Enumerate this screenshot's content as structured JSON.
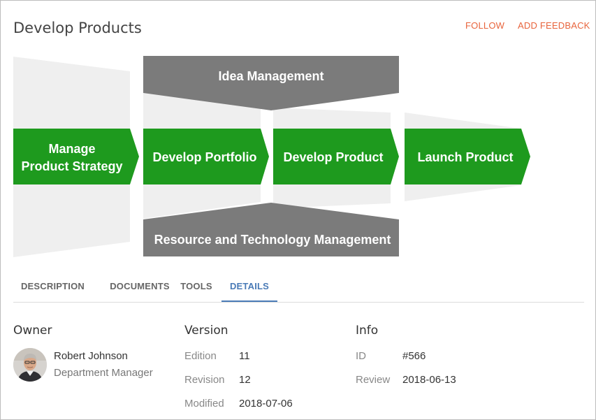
{
  "header": {
    "title": "Develop Products",
    "follow_label": "FOLLOW",
    "feedback_label": "ADD FEEDBACK"
  },
  "process": {
    "top_band": "Idea Management",
    "bottom_band": "Resource and Technology Management",
    "steps": [
      {
        "line1": "Manage",
        "line2": "Product Strategy"
      },
      {
        "line1": "Develop Portfolio"
      },
      {
        "line1": "Develop Product"
      },
      {
        "line1": "Launch Product"
      }
    ],
    "colors": {
      "step": "#1e9a1e",
      "band": "#7b7b7b",
      "ghost": "#efefef"
    }
  },
  "tabs": [
    {
      "label": "DESCRIPTION",
      "active": false
    },
    {
      "label": "DOCUMENTS",
      "active": false
    },
    {
      "label": "TOOLS",
      "active": false
    },
    {
      "label": "DETAILS",
      "active": true
    }
  ],
  "details": {
    "owner": {
      "heading": "Owner",
      "name": "Robert Johnson",
      "role": "Department Manager"
    },
    "version": {
      "heading": "Version",
      "rows": [
        {
          "label": "Edition",
          "value": "11"
        },
        {
          "label": "Revision",
          "value": "12"
        },
        {
          "label": "Modified",
          "value": "2018-07-06"
        }
      ]
    },
    "info": {
      "heading": "Info",
      "rows": [
        {
          "label": "ID",
          "value": "#566"
        },
        {
          "label": "Review",
          "value": "2018-06-13"
        }
      ]
    }
  }
}
